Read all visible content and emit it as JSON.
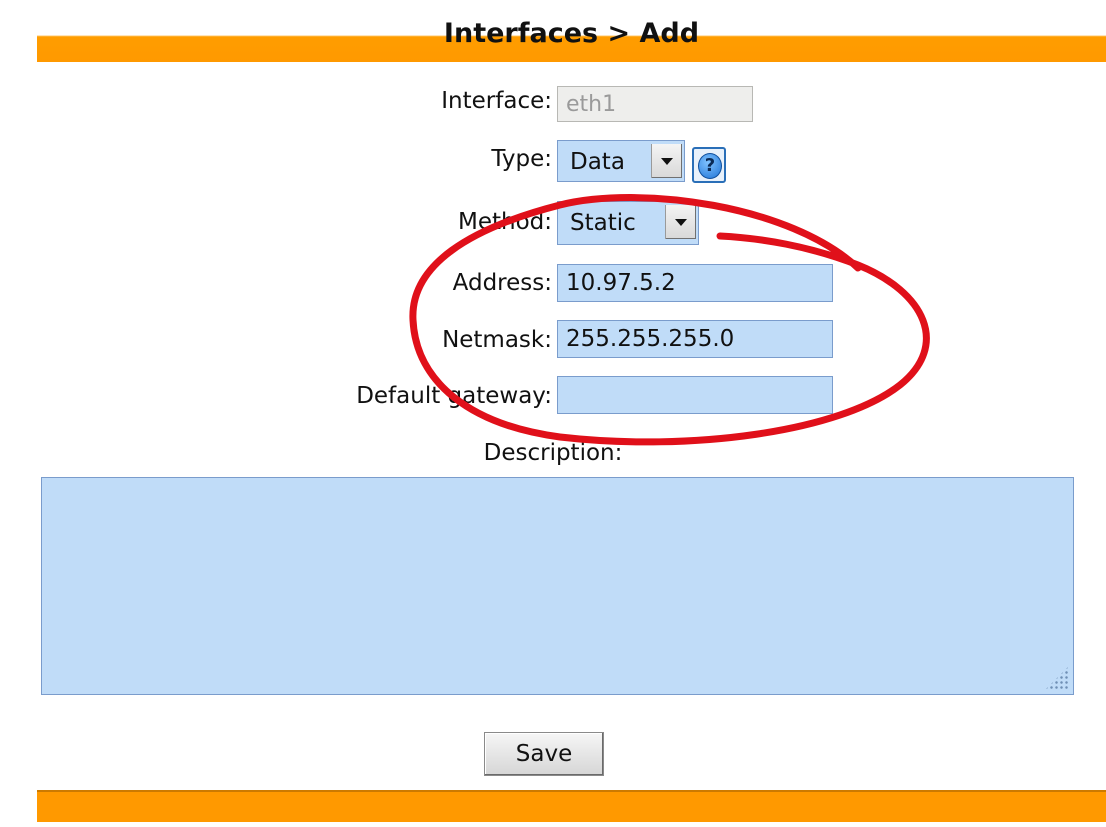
{
  "header": {
    "title": "Interfaces > Add"
  },
  "form": {
    "interface": {
      "label": "Interface:",
      "value": "eth1"
    },
    "type": {
      "label": "Type:",
      "selected": "Data"
    },
    "method": {
      "label": "Method:",
      "selected": "Static"
    },
    "address": {
      "label": "Address:",
      "value": "10.97.5.2"
    },
    "netmask": {
      "label": "Netmask:",
      "value": "255.255.255.0"
    },
    "gateway": {
      "label": "Default gateway:",
      "value": ""
    },
    "description": {
      "label": "Description:",
      "value": ""
    }
  },
  "actions": {
    "save_label": "Save"
  },
  "help": {
    "glyph": "?",
    "icon": "help-icon"
  },
  "colors": {
    "accent": "#ff9900",
    "input_bg": "#c0dcf8",
    "annotation": "#e0101a"
  }
}
